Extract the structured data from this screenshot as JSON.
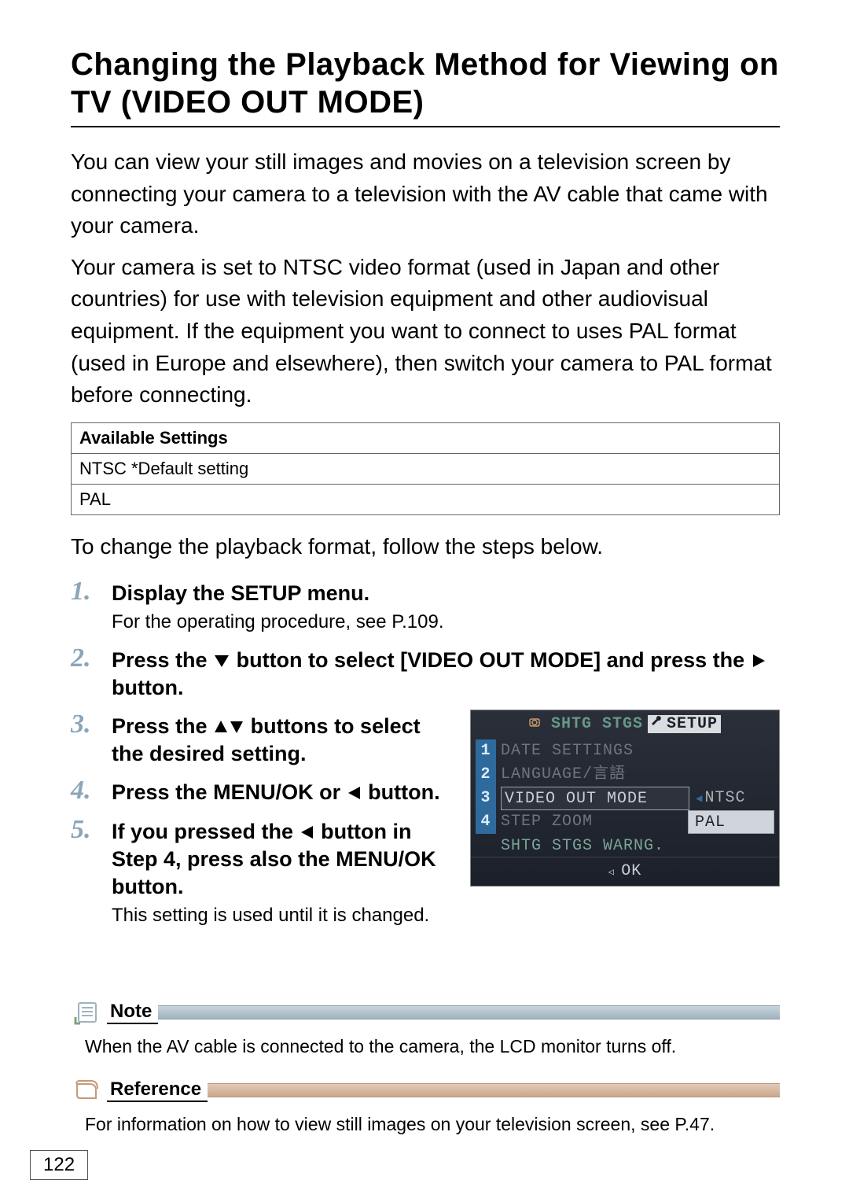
{
  "title": "Changing the Playback Method for Viewing on TV (VIDEO OUT MODE)",
  "intro1": "You can view your still images and movies on a television screen by connecting your camera to a television with the AV cable that came with your camera.",
  "intro2": "Your camera is set to NTSC video format (used in Japan and other countries) for use with television equipment and other audiovisual equipment. If the equipment you want to connect to uses PAL format (used in Europe and elsewhere), then switch your camera to PAL format before connecting.",
  "settings_header": "Available Settings",
  "settings_rows": [
    "NTSC *Default setting",
    "PAL"
  ],
  "lead": "To change the playback format, follow the steps below.",
  "steps": {
    "s1": {
      "num": "1.",
      "title": "Display the SETUP menu.",
      "sub": "For the operating procedure, see P.109."
    },
    "s2": {
      "num": "2.",
      "title_a": "Press the ",
      "title_b": " button to select [VIDEO OUT MODE] and press the ",
      "title_c": " button."
    },
    "s3": {
      "num": "3.",
      "title_a": "Press the ",
      "title_b": " buttons to select the desired setting."
    },
    "s4": {
      "num": "4.",
      "title_a": "Press the ",
      "menuok": "MENU/OK",
      "title_b": " or ",
      "title_c": " button."
    },
    "s5": {
      "num": "5.",
      "title_a": "If you pressed the ",
      "title_b": " button in Step 4, press also the ",
      "menuok": "MENU/OK",
      "title_c": " button.",
      "sub": "This setting is used until it is changed."
    }
  },
  "lcd": {
    "tab_dim": "SHTG STGS",
    "tab_active": "SETUP",
    "rows": [
      {
        "idx": "1",
        "label": "DATE SETTINGS"
      },
      {
        "idx": "2",
        "label": "LANGUAGE/言語"
      },
      {
        "idx": "3",
        "label": "VIDEO OUT MODE",
        "lit": true,
        "opts": [
          "NTSC",
          "PAL"
        ]
      },
      {
        "idx": "4",
        "label": "STEP ZOOM"
      }
    ],
    "warn": "SHTG STGS WARNG.",
    "ok": "OK"
  },
  "note": {
    "label": "Note",
    "body": "When the AV cable is connected to the camera, the LCD monitor turns off."
  },
  "reference": {
    "label": "Reference",
    "body": "For information on how to view still images on your television screen, see P.47."
  },
  "page_number": "122"
}
